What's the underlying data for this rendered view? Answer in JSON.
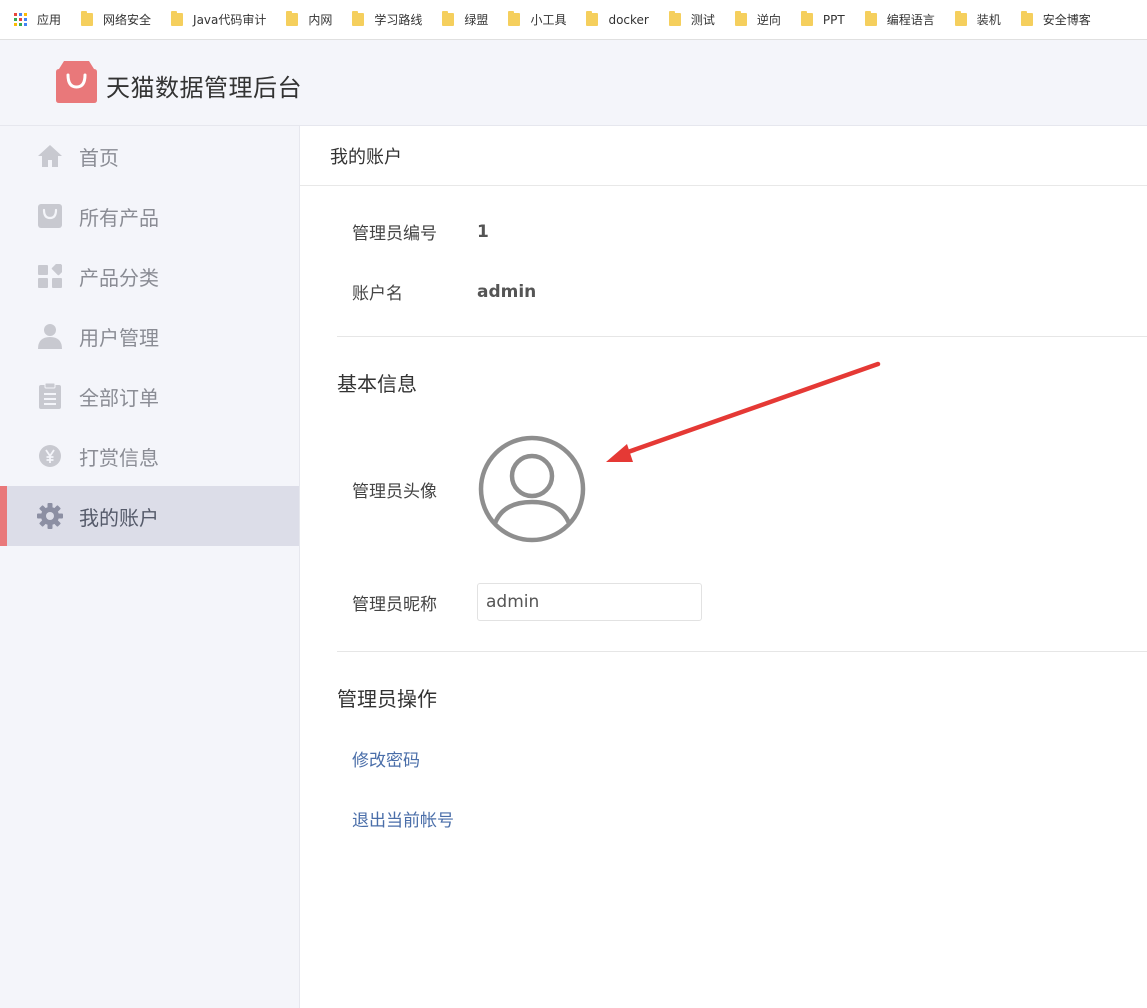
{
  "bookmarks": {
    "apps_label": "应用",
    "items": [
      "网络安全",
      "Java代码审计",
      "内网",
      "学习路线",
      "绿盟",
      "小工具",
      "docker",
      "测试",
      "逆向",
      "PPT",
      "编程语言",
      "装机",
      "安全博客"
    ]
  },
  "header": {
    "site_title": "天猫数据管理后台",
    "logo_icon": "shopping-bag-icon",
    "logo_color": "#e9787a"
  },
  "sidebar": {
    "items": [
      {
        "label": "首页",
        "icon": "home-icon"
      },
      {
        "label": "所有产品",
        "icon": "bag-icon"
      },
      {
        "label": "产品分类",
        "icon": "category-icon"
      },
      {
        "label": "用户管理",
        "icon": "user-icon"
      },
      {
        "label": "全部订单",
        "icon": "clipboard-icon"
      },
      {
        "label": "打赏信息",
        "icon": "yen-icon"
      },
      {
        "label": "我的账户",
        "icon": "gear-icon"
      }
    ],
    "active_index": 6,
    "accent_color": "#e9787a"
  },
  "main": {
    "page_title": "我的账户",
    "admin_id_label": "管理员编号",
    "admin_id_value": "1",
    "account_name_label": "账户名",
    "account_name_value": "admin",
    "basic_info_title": "基本信息",
    "avatar_label": "管理员头像",
    "nickname_label": "管理员昵称",
    "nickname_value": "admin",
    "operations_title": "管理员操作",
    "change_password_link": "修改密码",
    "logout_link": "退出当前帐号"
  },
  "annotation": {
    "arrow_color": "#e53935"
  }
}
